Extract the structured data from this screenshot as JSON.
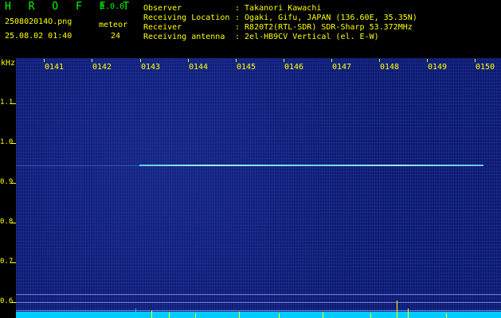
{
  "header": {
    "logo": "H R O F F T",
    "version": "1.0.0",
    "filename": "250802014O.png",
    "datetime": "25.08.02 01:40",
    "meteor_label": "meteor",
    "meteor_count": "24",
    "observer_label": "Observer",
    "observer_value": ": Takanori Kawachi",
    "location_label": "Receiving Location",
    "location_value": ": Ogaki, Gifu, JAPAN (136.60E, 35.35N)",
    "receiver_label": "Receiver",
    "receiver_value": ": R820T2(RTL-SDR) SDR-Sharp 53.372MHz",
    "antenna_label": "Receiving antenna",
    "antenna_value": ": 2el-HB9CV Vertical (el. E-W)"
  },
  "axes": {
    "y_unit": "kHz",
    "y_ticks": [
      "1.1",
      "1.0",
      "0.9",
      "0.8",
      "0.7",
      "0.6"
    ],
    "x_ticks": [
      "0141",
      "0142",
      "0143",
      "0144",
      "0145",
      "0146",
      "0147",
      "0148",
      "0149",
      "0150"
    ]
  },
  "colors": {
    "text": "#ffff00",
    "logo": "#00ff00",
    "background": "#0c1a6e",
    "echo": "#8fe8ff",
    "band": "#00ccff"
  }
}
